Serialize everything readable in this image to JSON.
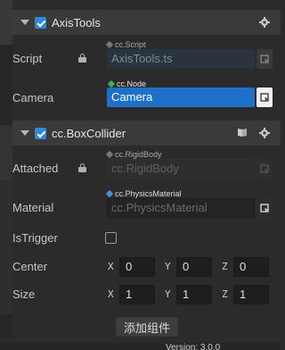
{
  "components": {
    "axis_tools": {
      "title": "AxisTools",
      "script_label": "Script",
      "script_tag": "cc.Script",
      "script_value": "AxisTools.ts",
      "camera_label": "Camera",
      "camera_tag": "cc.Node",
      "camera_value": "Camera"
    },
    "box_collider": {
      "title": "cc.BoxCollider",
      "attached_label": "Attached",
      "attached_tag": "cc.RigidBody",
      "attached_value": "cc.RigidBody",
      "material_label": "Material",
      "material_tag": "cc.PhysicsMaterial",
      "material_value": "cc.PhysicsMaterial",
      "istrigger_label": "IsTrigger",
      "center_label": "Center",
      "center": {
        "x_label": "X",
        "x": "0",
        "y_label": "Y",
        "y": "0",
        "z_label": "Z",
        "z": "0"
      },
      "size_label": "Size",
      "size": {
        "x_label": "X",
        "x": "1",
        "y_label": "Y",
        "y": "1",
        "z_label": "Z",
        "z": "1"
      }
    }
  },
  "add_component_label": "添加组件",
  "version_text": "Version: 3.0.0",
  "colors": {
    "accent": "#1f70c8",
    "checkbox": "#2b89e0",
    "panel": "#2b2b2b",
    "header": "#3a3a3a"
  }
}
